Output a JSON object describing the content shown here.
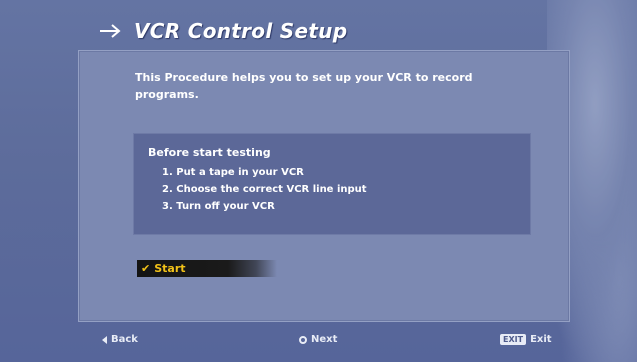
{
  "header": {
    "title": "VCR Control Setup"
  },
  "main": {
    "description": "This Procedure helps you to set up your VCR to record programs.",
    "info": {
      "heading": "Before start testing",
      "steps": [
        "1. Put a tape in your VCR",
        "2. Choose the correct VCR line input",
        "3. Turn off your VCR"
      ]
    },
    "start_label": "Start"
  },
  "footer": {
    "back_label": "Back",
    "next_label": "Next",
    "exit_key": "EXIT",
    "exit_label": "Exit"
  },
  "colors": {
    "background": "#5d6c9b",
    "panel": "#7c89b2",
    "info_box": "#5c6898",
    "highlight_text": "#f2c218"
  }
}
